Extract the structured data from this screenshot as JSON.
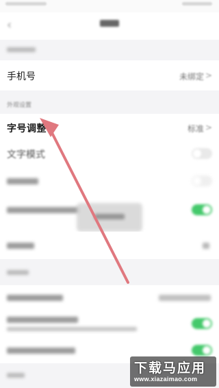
{
  "rows": {
    "phone": {
      "label": "手机号",
      "value": "未绑定"
    },
    "font_size": {
      "label": "字号调整",
      "value": "标准"
    },
    "text_mode": {
      "label": "文字模式"
    }
  },
  "sections": {
    "appearance": {
      "title": "外观设置"
    }
  },
  "icons": {
    "chevron": "chevron-right-icon",
    "back": "back-arrow-icon"
  },
  "colors": {
    "toggle_on": "#44c96b",
    "section_bg": "#f4f4f6",
    "arrow": "#e0787f"
  },
  "toggles": {
    "text_mode_on": false,
    "row_on_1": true,
    "row_on_2": true,
    "row_on_3": true
  },
  "watermark": {
    "logo": "下载马应用",
    "url": "www.xiazaimao.com"
  }
}
